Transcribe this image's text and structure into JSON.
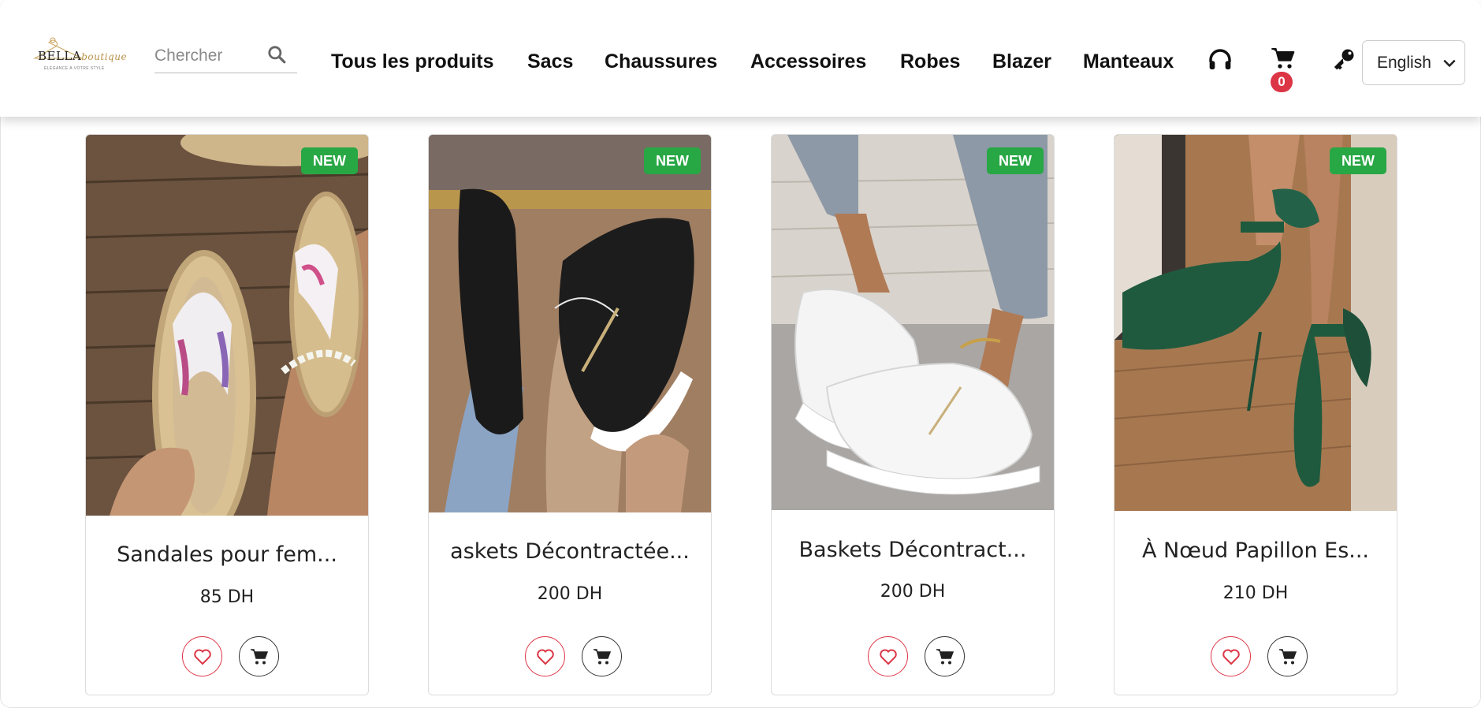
{
  "brand": {
    "name": "BELLA",
    "script": "boutique",
    "tagline": "ÉLÉGANCE À VOTRE STYLE"
  },
  "search": {
    "placeholder": "Chercher"
  },
  "nav": {
    "items": [
      "Tous les produits",
      "Sacs",
      "Chaussures",
      "Accessoires",
      "Robes",
      "Blazer",
      "Manteaux"
    ]
  },
  "header_icons": [
    "headphones-icon",
    "shopping-cart-icon",
    "key-icon"
  ],
  "cart": {
    "count": "0"
  },
  "language": {
    "selected": "English"
  },
  "colors": {
    "new_badge": "#28a745",
    "cart_badge": "#dc3545",
    "fav": "#dc3545"
  },
  "products": [
    {
      "title": "Sandales pour fem...",
      "price": "85 DH",
      "badge": "NEW",
      "image": "flip-flop sandals with floral satin straps"
    },
    {
      "title": "askets Décontractée...",
      "price": "200 DH",
      "badge": "NEW",
      "image": "black textured sneakers with side zip"
    },
    {
      "title": "Baskets Décontract...",
      "price": "200 DH",
      "badge": "NEW",
      "image": "white textured sneakers with side zip"
    },
    {
      "title": "À Nœud Papillon Es...",
      "price": "210 DH",
      "badge": "NEW",
      "image": "green satin pointed heels with bow"
    }
  ]
}
